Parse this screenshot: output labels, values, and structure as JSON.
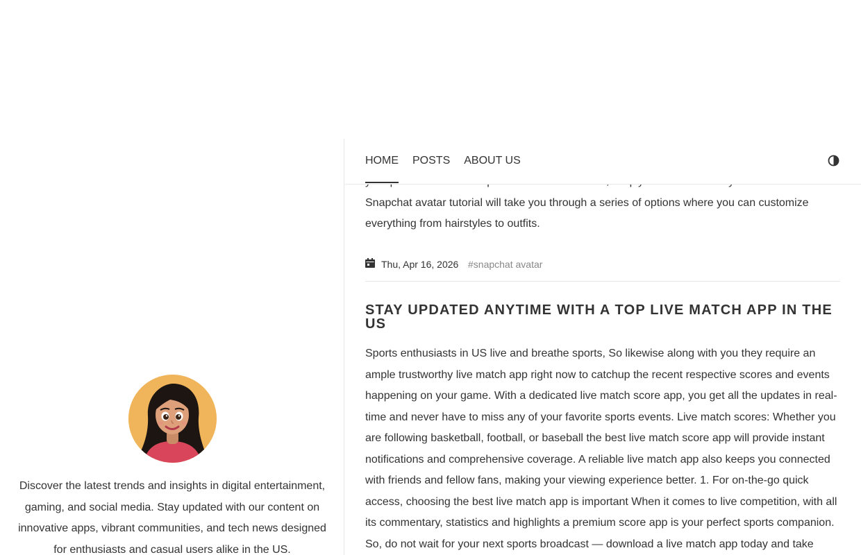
{
  "nav": {
    "items": [
      {
        "label": "HOME"
      },
      {
        "label": "POSTS"
      },
      {
        "label": "ABOUT US"
      }
    ],
    "theme_toggle_icon": "contrast-half-circle-icon"
  },
  "sidebar": {
    "avatar_icon": "cartoon-girl-avatar",
    "description": "Discover the latest trends and insights in digital entertainment, gaming, and social media. Stay updated with our content on innovative apps, vibrant communities, and tech news designed for enthusiasts and casual users alike in the US."
  },
  "previous_post": {
    "excerpt_partial": "your profile icon at the top-left corner. From there, simply select \"Create My Avatar.\" This Snapchat avatar tutorial will take you through a series of options where you can customize everything from hairstyles to outfits.",
    "date": "Thu, Apr 16, 2026",
    "tag": "#snapchat avatar"
  },
  "post": {
    "title": "STAY UPDATED ANYTIME WITH A TOP LIVE MATCH APP IN THE US",
    "body": "Sports enthusiasts in US live and breathe sports, So likewise along with you they require an ample trustworthy live match app right now to catchup the recent respective scores and events happening on your game. With a dedicated live match score app, you get all the updates in real-time and never have to miss any of your favorite sports events. Live match scores: Whether you are following basketball, football, or baseball the best live match score app will provide instant notifications and comprehensive coverage. A reliable live match app also keeps you connected with friends and fellow fans, making your viewing experience better. 1. For on-the-go quick access, choosing the best live match app is important When it comes to live competition, with all its commentary, statistics and highlights a premium score app is your perfect sports companion. So, do not wait for your next sports broadcast — download a live match app today and take"
  },
  "colors": {
    "text": "#333333",
    "muted": "#888888",
    "border": "#e5e5e5",
    "avatar_bg": "#f0b55a"
  }
}
